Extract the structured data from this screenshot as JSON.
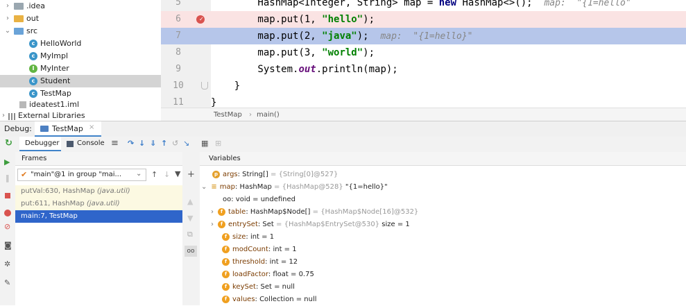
{
  "project_tree": {
    "items": [
      {
        "label": ".idea",
        "icon": "folder-gray-icon",
        "arrow": ">"
      },
      {
        "label": "out",
        "icon": "folder-orange-icon",
        "arrow": ">"
      },
      {
        "label": "src",
        "icon": "folder-blue-icon",
        "arrow": "v"
      },
      {
        "label": "HelloWorld",
        "icon": "class-icon"
      },
      {
        "label": "MyImpl",
        "icon": "class-icon"
      },
      {
        "label": "MyInter",
        "icon": "interface-icon"
      },
      {
        "label": "Student",
        "icon": "class-icon"
      },
      {
        "label": "TestMap",
        "icon": "class-icon"
      },
      {
        "label": "ideatest1.iml",
        "icon": "iml-file-icon"
      },
      {
        "label": "External Libraries",
        "icon": "libraries-icon",
        "arrow": ">"
      }
    ]
  },
  "editor": {
    "line_numbers": [
      "5",
      "6",
      "7",
      "8",
      "9",
      "10",
      "11"
    ],
    "lines": {
      "l5": {
        "a": "        HashMap<Integer, String> map = ",
        "kw": "new",
        "b": " HashMap<>();  ",
        "hint": "map:  \"{1=hello\""
      },
      "l6": {
        "a": "        map.put(1, ",
        "str": "\"hello\"",
        "b": ");"
      },
      "l7": {
        "a": "        map.put(2, ",
        "str": "\"java\"",
        "b": ");  ",
        "hint": "map:  \"{1=hello}\""
      },
      "l8": {
        "a": "        map.put(3, ",
        "str": "\"world\"",
        "b": ");"
      },
      "l9": {
        "a": "        System.",
        "fld": "out",
        "b": ".println(map);"
      },
      "l10": {
        "a": "    }"
      },
      "l11": {
        "a": "}"
      }
    },
    "breadcrumb": {
      "class": "TestMap",
      "sep": "›",
      "method": "main()"
    }
  },
  "debug": {
    "label": "Debug:",
    "config_tab": "TestMap",
    "debugger_tab": "Debugger",
    "console_tab": "Console",
    "frames_header": "Frames",
    "variables_header": "Variables",
    "thread_select": "\"main\"@1 in group \"mai...",
    "frames": [
      {
        "method": "putVal:630, HashMap",
        "pkg": "(java.util)"
      },
      {
        "method": "put:611, HashMap",
        "pkg": "(java.util)"
      },
      {
        "method": "main:7, TestMap",
        "pkg": ""
      }
    ],
    "variables": [
      {
        "icon": "p",
        "name": "args",
        "type": ": String[]",
        "val": " = {String[0]@527}",
        "extra": ""
      },
      {
        "icon": "m",
        "name": "map",
        "type": ": HashMap",
        "val": " = {HashMap@528}",
        "extra": " \"{1=hello}\""
      },
      {
        "icon": "oo",
        "name": "oo: void",
        "type": "",
        "val": " = undefined",
        "extra": ""
      },
      {
        "icon": "f",
        "name": "table",
        "type": ": HashMap$Node[]",
        "val": " = {HashMap$Node[16]@532}",
        "extra": ""
      },
      {
        "icon": "f",
        "name": "entrySet",
        "type": ": Set",
        "val": " = {HashMap$EntrySet@530}",
        "extra": "  size = 1"
      },
      {
        "icon": "f",
        "name": "size",
        "type": ": int",
        "val": " = 1",
        "extra": ""
      },
      {
        "icon": "f",
        "name": "modCount",
        "type": ": int",
        "val": " = 1",
        "extra": ""
      },
      {
        "icon": "f",
        "name": "threshold",
        "type": ": int",
        "val": " = 12",
        "extra": ""
      },
      {
        "icon": "f",
        "name": "loadFactor",
        "type": ": float",
        "val": " = 0.75",
        "extra": ""
      },
      {
        "icon": "f",
        "name": "keySet",
        "type": ": Set",
        "val": " = null",
        "extra": ""
      },
      {
        "icon": "f",
        "name": "values",
        "type": ": Collection",
        "val": " = null",
        "extra": ""
      }
    ]
  },
  "colors": {
    "breakpoint": "#d9534f",
    "selection": "#2f65ca",
    "current_line": "#b6c6ea"
  }
}
